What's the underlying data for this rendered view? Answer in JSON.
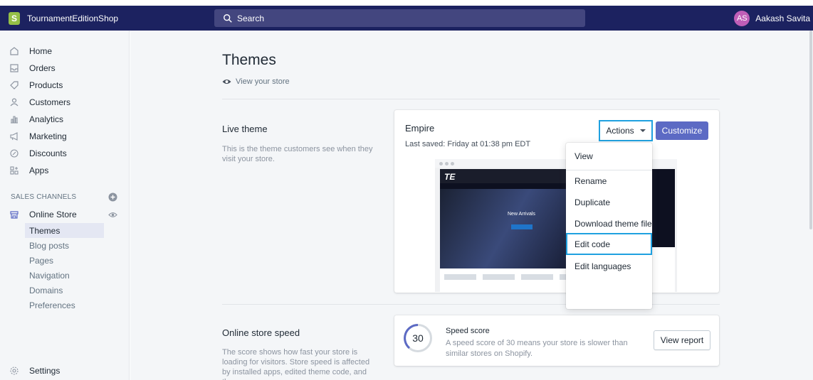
{
  "topbar": {
    "brand": "TournamentEditionShop",
    "search_placeholder": "Search",
    "avatar_initials": "AS",
    "user_name": "Aakash Savita"
  },
  "sidebar": {
    "items": [
      {
        "label": "Home",
        "icon": "home-icon"
      },
      {
        "label": "Orders",
        "icon": "orders-icon"
      },
      {
        "label": "Products",
        "icon": "tag-icon"
      },
      {
        "label": "Customers",
        "icon": "person-icon"
      },
      {
        "label": "Analytics",
        "icon": "bar-chart-icon"
      },
      {
        "label": "Marketing",
        "icon": "megaphone-icon"
      },
      {
        "label": "Discounts",
        "icon": "discount-icon"
      },
      {
        "label": "Apps",
        "icon": "apps-icon"
      }
    ],
    "sales_channels_label": "SALES CHANNELS",
    "online_store": "Online Store",
    "sub_items": [
      "Themes",
      "Blog posts",
      "Pages",
      "Navigation",
      "Domains",
      "Preferences"
    ],
    "settings": "Settings"
  },
  "main": {
    "title": "Themes",
    "view_store": "View your store",
    "live_theme": {
      "heading": "Live theme",
      "description": "This is the theme customers see when they visit your store.",
      "theme_name": "Empire",
      "last_saved": "Last saved: Friday at 01:38 pm EDT",
      "actions_label": "Actions",
      "customize_label": "Customize",
      "preview": {
        "logo": "TE",
        "hero_text": "New Arrivals"
      }
    },
    "actions_menu": [
      "View",
      "Rename",
      "Duplicate",
      "Download theme file",
      "Edit code",
      "Edit languages"
    ],
    "speed": {
      "heading": "Online store speed",
      "description": "The score shows how fast your store is loading for visitors. Store speed is affected by installed apps, edited theme code, and the",
      "score": "30",
      "score_title": "Speed score",
      "score_desc": "A speed score of 30 means your store is slower than similar stores on Shopify.",
      "report_label": "View report"
    }
  },
  "colors": {
    "topbar": "#1c2260",
    "accent": "#5c6ac4",
    "highlight": "#1fa1e0",
    "brand_green": "#95bf47"
  }
}
